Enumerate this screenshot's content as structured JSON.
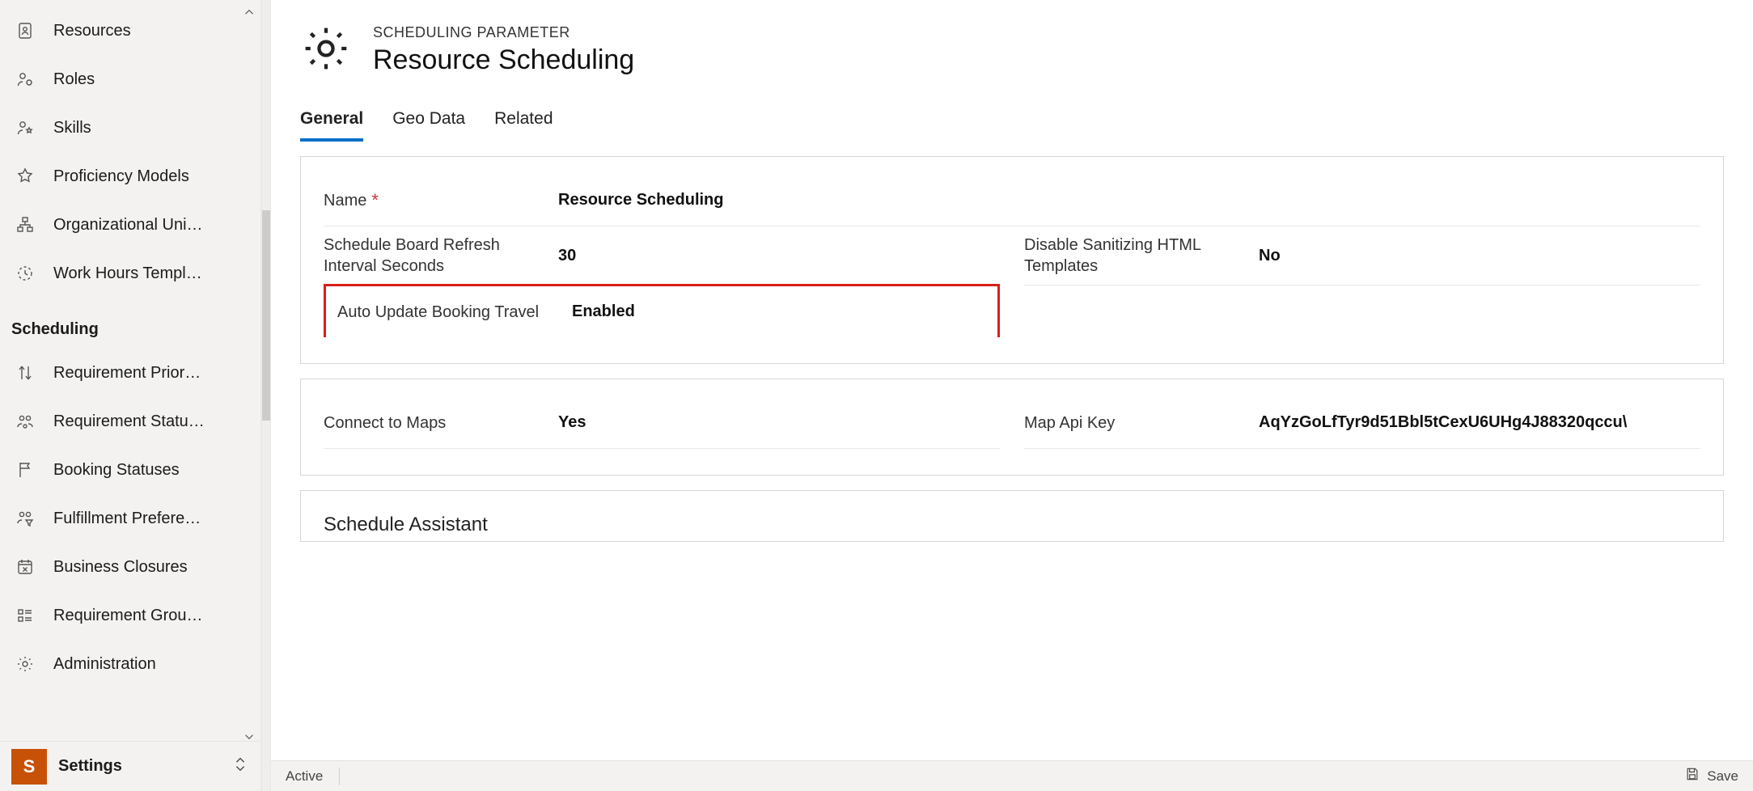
{
  "sidebar": {
    "groups": [
      {
        "items": [
          {
            "label": "Resources",
            "icon": "clipboard-person-icon"
          },
          {
            "label": "Roles",
            "icon": "person-cog-icon"
          },
          {
            "label": "Skills",
            "icon": "person-star-icon"
          },
          {
            "label": "Proficiency Models",
            "icon": "star-icon"
          },
          {
            "label": "Organizational Uni…",
            "icon": "org-chart-icon"
          },
          {
            "label": "Work Hours Templ…",
            "icon": "clock-dashed-icon"
          }
        ]
      },
      {
        "title": "Scheduling",
        "items": [
          {
            "label": "Requirement Prior…",
            "icon": "up-down-arrow-icon"
          },
          {
            "label": "Requirement Statu…",
            "icon": "people-status-icon"
          },
          {
            "label": "Booking Statuses",
            "icon": "flag-icon"
          },
          {
            "label": "Fulfillment Prefere…",
            "icon": "people-filter-icon"
          },
          {
            "label": "Business Closures",
            "icon": "calendar-x-icon"
          },
          {
            "label": "Requirement Grou…",
            "icon": "requirement-list-icon"
          },
          {
            "label": "Administration",
            "icon": "gear-icon"
          }
        ]
      }
    ],
    "area": {
      "letter": "S",
      "name": "Settings"
    }
  },
  "header": {
    "entity_label": "SCHEDULING PARAMETER",
    "title": "Resource Scheduling"
  },
  "tabs": [
    {
      "label": "General",
      "active": true
    },
    {
      "label": "Geo Data",
      "active": false
    },
    {
      "label": "Related",
      "active": false
    }
  ],
  "form": {
    "name": {
      "label": "Name",
      "required": true,
      "value": "Resource Scheduling"
    },
    "refresh": {
      "label": "Schedule Board Refresh Interval Seconds",
      "value": "30"
    },
    "disable_sanitize": {
      "label": "Disable Sanitizing HTML Templates",
      "value": "No"
    },
    "auto_update_travel": {
      "label": "Auto Update Booking Travel",
      "value": "Enabled"
    },
    "connect_maps": {
      "label": "Connect to Maps",
      "value": "Yes"
    },
    "map_api_key": {
      "label": "Map Api Key",
      "value": "AqYzGoLfTyr9d51Bbl5tCexU6UHg4J88320qccu\\"
    },
    "section_schedule_assistant": "Schedule Assistant"
  },
  "statusbar": {
    "status": "Active",
    "save_label": "Save"
  }
}
